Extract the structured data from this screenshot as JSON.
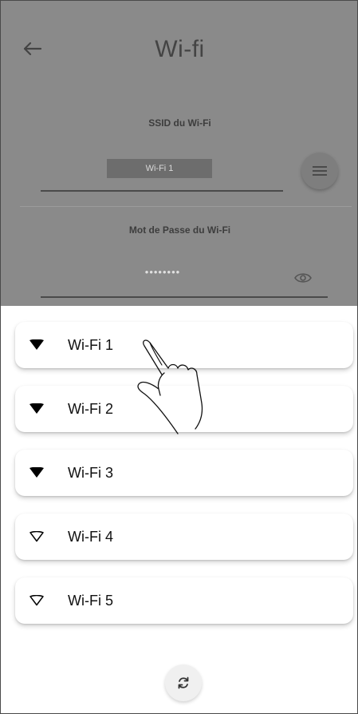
{
  "header": {
    "title": "Wi-fi",
    "back_icon": "arrow-left-icon"
  },
  "form": {
    "ssid_label": "SSID du Wi-Fi",
    "ssid_value": "Wi-Fi 1",
    "list_button_icon": "list-icon",
    "password_label": "Mot de Passe du Wi-Fi",
    "password_value": "••••••••",
    "visibility_icon": "eye-icon"
  },
  "networks": [
    {
      "name": "Wi-Fi 1",
      "icon": "wifi-filled-icon"
    },
    {
      "name": "Wi-Fi 2",
      "icon": "wifi-filled-icon"
    },
    {
      "name": "Wi-Fi 3",
      "icon": "wifi-filled-icon"
    },
    {
      "name": "Wi-Fi 4",
      "icon": "wifi-outline-icon"
    },
    {
      "name": "Wi-Fi 5",
      "icon": "wifi-outline-icon"
    }
  ],
  "refresh_icon": "refresh-icon",
  "colors": {
    "dim_overlay": "#8a8a8a",
    "text": "#111111",
    "sheet_bg": "#ffffff"
  }
}
